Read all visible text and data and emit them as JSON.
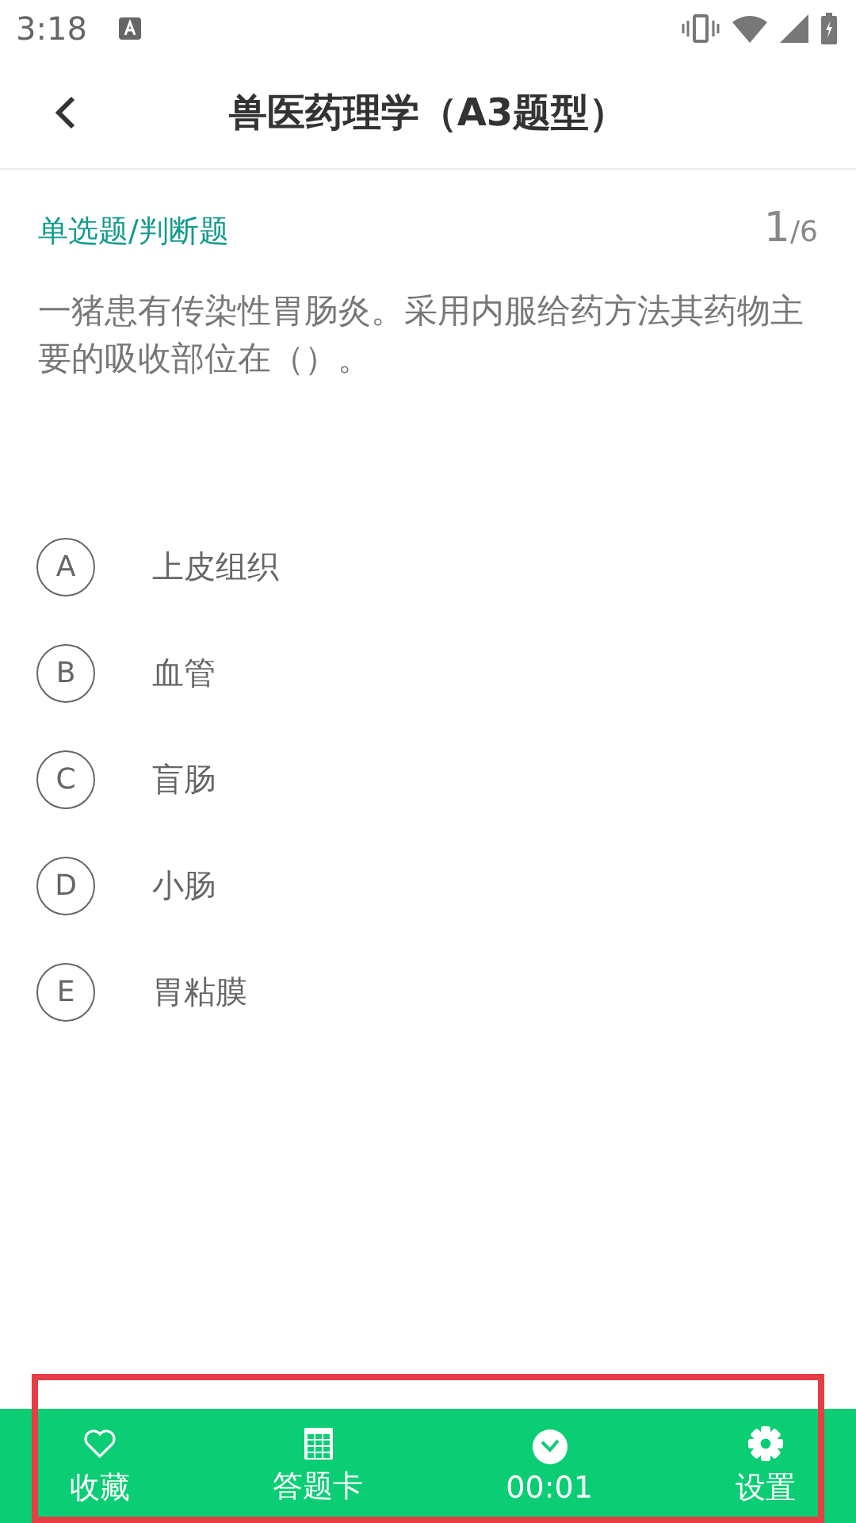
{
  "status_bar": {
    "time": "3:18"
  },
  "header": {
    "title": "兽医药理学（A3题型）"
  },
  "question": {
    "type_label": "单选题/判断题",
    "current": "1",
    "total": "/6",
    "text": "一猪患有传染性胃肠炎。采用内服给药方法其药物主要的吸收部位在（）。"
  },
  "options": [
    {
      "letter": "A",
      "text": "上皮组织",
      "selected": false
    },
    {
      "letter": "B",
      "text": "血管",
      "selected": false
    },
    {
      "letter": "C",
      "text": "盲肠",
      "selected": false
    },
    {
      "letter": "D",
      "text": "小肠",
      "selected": false
    },
    {
      "letter": "E",
      "text": "胃粘膜",
      "selected": false
    }
  ],
  "bottom_bar": [
    {
      "kind": "favorite",
      "label": "收藏"
    },
    {
      "kind": "card",
      "label": "答题卡"
    },
    {
      "kind": "timer",
      "label": "00:01"
    },
    {
      "kind": "settings",
      "label": "设置"
    }
  ]
}
